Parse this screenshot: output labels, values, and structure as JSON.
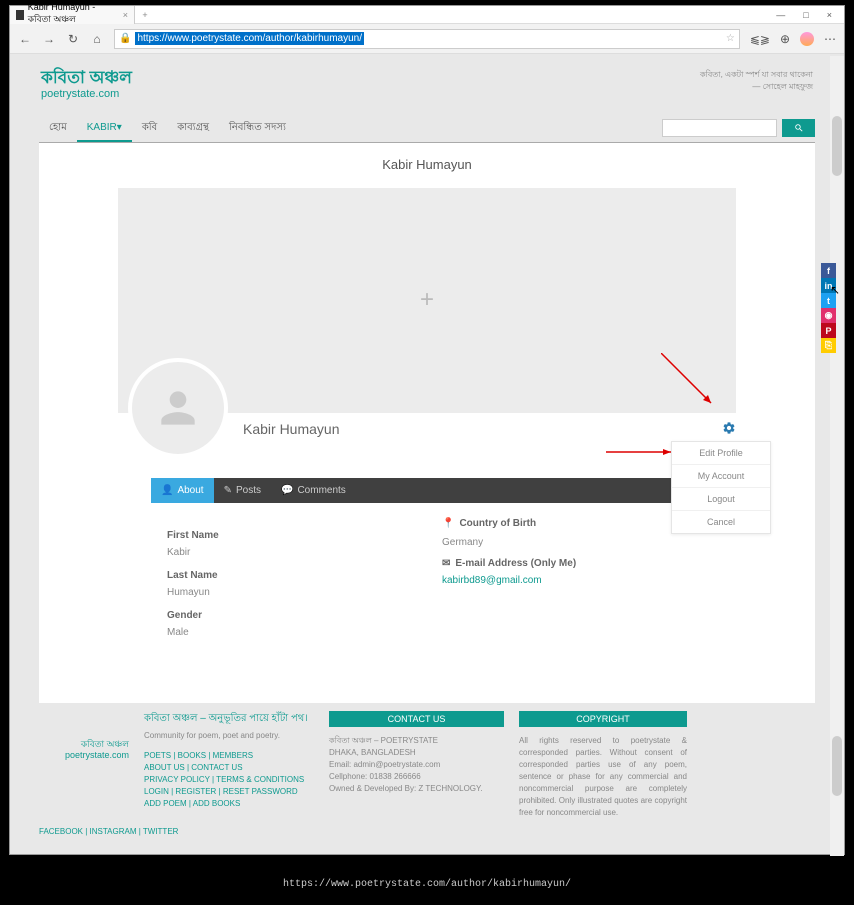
{
  "browser": {
    "tab_title": "Kabir Humayun - কবিতা অঞ্চল",
    "url": "https://www.poetrystate.com/author/kabirhumayun/",
    "win_min": "—",
    "win_max": "□",
    "win_close": "×"
  },
  "site": {
    "logo_bn": "কবিতা অঞ্চল",
    "logo_en": "poetrystate.com",
    "tagline1": "কবিতা, একটা স্পর্শ যা সবার থাকেনা",
    "tagline2": "— সোহেল মাহফুজ"
  },
  "nav": {
    "home": "হোম",
    "kabir": "KABIR ",
    "kobi": "কবি",
    "kabyogrontho": "কাব্যগ্রন্থ",
    "members": "নিবন্ধিত সদস্য"
  },
  "profile": {
    "title": "Kabir Humayun",
    "name": "Kabir Humayun",
    "tabs": {
      "about": "About",
      "posts": "Posts",
      "comments": "Comments"
    },
    "fields": {
      "first_name_lbl": "First Name",
      "first_name": "Kabir",
      "last_name_lbl": "Last Name",
      "last_name": "Humayun",
      "gender_lbl": "Gender",
      "gender": "Male",
      "country_lbl": "Country of Birth",
      "country": "Germany",
      "email_lbl": "E-mail Address (Only Me)",
      "email": "kabirbd89@gmail.com"
    },
    "menu": {
      "edit": "Edit Profile",
      "account": "My Account",
      "logout": "Logout",
      "cancel": "Cancel"
    }
  },
  "footer": {
    "heading_bn": "কবিতা অঞ্চল – অনুভূতির পায়ে হাঁটা পথ।",
    "sub": "Community for poem, poet and poetry.",
    "links1": "POETS | BOOKS | MEMBERS",
    "links2": "ABOUT US | CONTACT US",
    "links3": "PRIVACY POLICY | TERMS & CONDITIONS",
    "links4": "LOGIN | REGISTER | RESET PASSWORD",
    "links5": "ADD POEM | ADD BOOKS",
    "contact_title": "CONTACT US",
    "contact_l1": "কবিতা অঞ্চল – POETRYSTATE",
    "contact_l2": "DHAKA, BANGLADESH",
    "contact_l3": "Email: admin@poetrystate.com",
    "contact_l4": "Cellphone: 01838 266666",
    "contact_l5": "Owned & Developed By: Z TECHNOLOGY.",
    "copyright_title": "COPYRIGHT",
    "copyright_txt": "All rights reserved to poetrystate & corresponded parties. Without consent of corresponded parties use of any poem, sentence or phase for any commercial and noncommercial purpose are completely prohibited. Only illustrated quotes are copyright free for noncommercial use.",
    "social": "FACEBOOK | INSTAGRAM | TWITTER"
  },
  "bottom_url": "https://www.poetrystate.com/author/kabirhumayun/"
}
